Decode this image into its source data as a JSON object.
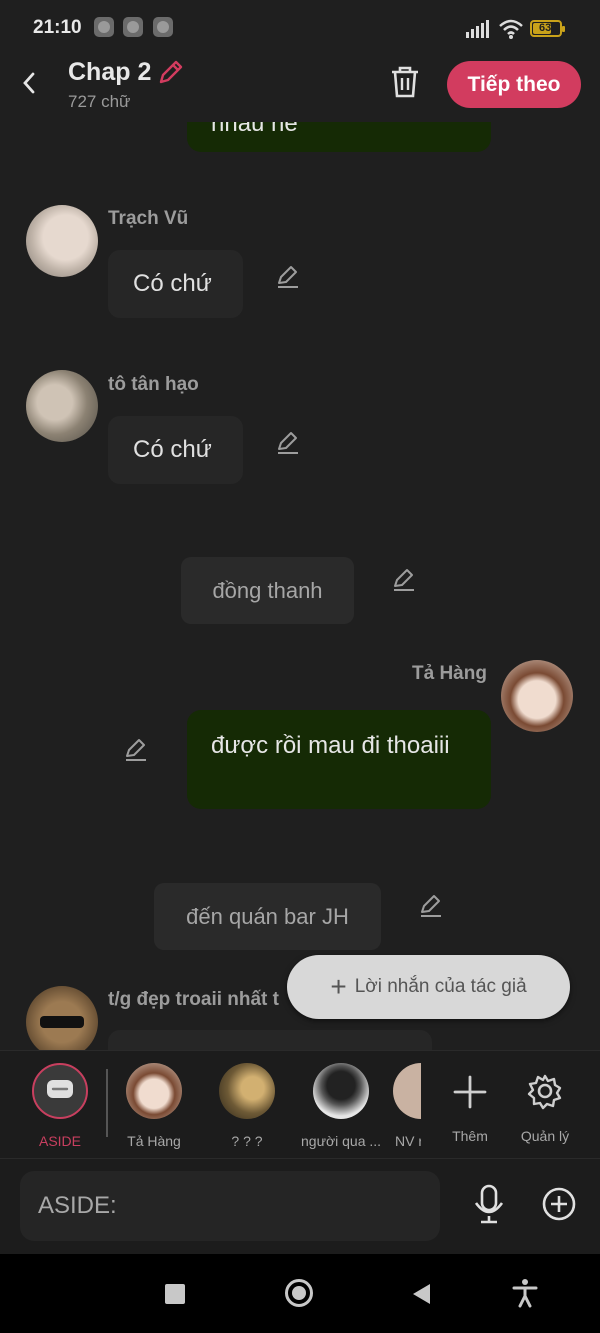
{
  "status_bar": {
    "time": "21:10",
    "battery": "63"
  },
  "header": {
    "title": "Chap 2",
    "word_count": "727 chữ",
    "next_label": "Tiếp theo"
  },
  "chat": {
    "top_partial_text": "nhau ne",
    "messages": [
      {
        "sender": "Trạch Vũ",
        "text": "Có chứ"
      },
      {
        "sender": "tô tân hạo",
        "text": "Có chứ"
      },
      {
        "narration": "đồng thanh"
      },
      {
        "sender": "Tả Hàng",
        "text": "được rồi mau đi thoaiii"
      },
      {
        "narration": "đến quán bar JH"
      },
      {
        "sender": "t/g đẹp troaii nhất t"
      }
    ]
  },
  "floating_button": {
    "label": "Lời nhắn của tác giả"
  },
  "characters": [
    {
      "label": "ASIDE",
      "active": true
    },
    {
      "label": "Tả Hàng"
    },
    {
      "label": "? ? ?"
    },
    {
      "label": "người qua ..."
    },
    {
      "label": "NV r"
    }
  ],
  "actions": {
    "add_label": "Thêm",
    "manage_label": "Quản lý"
  },
  "input": {
    "placeholder": "ASIDE:"
  },
  "colors": {
    "accent": "#d23c5f",
    "green_bubble": "#152a05",
    "background": "#1f1f1f"
  }
}
